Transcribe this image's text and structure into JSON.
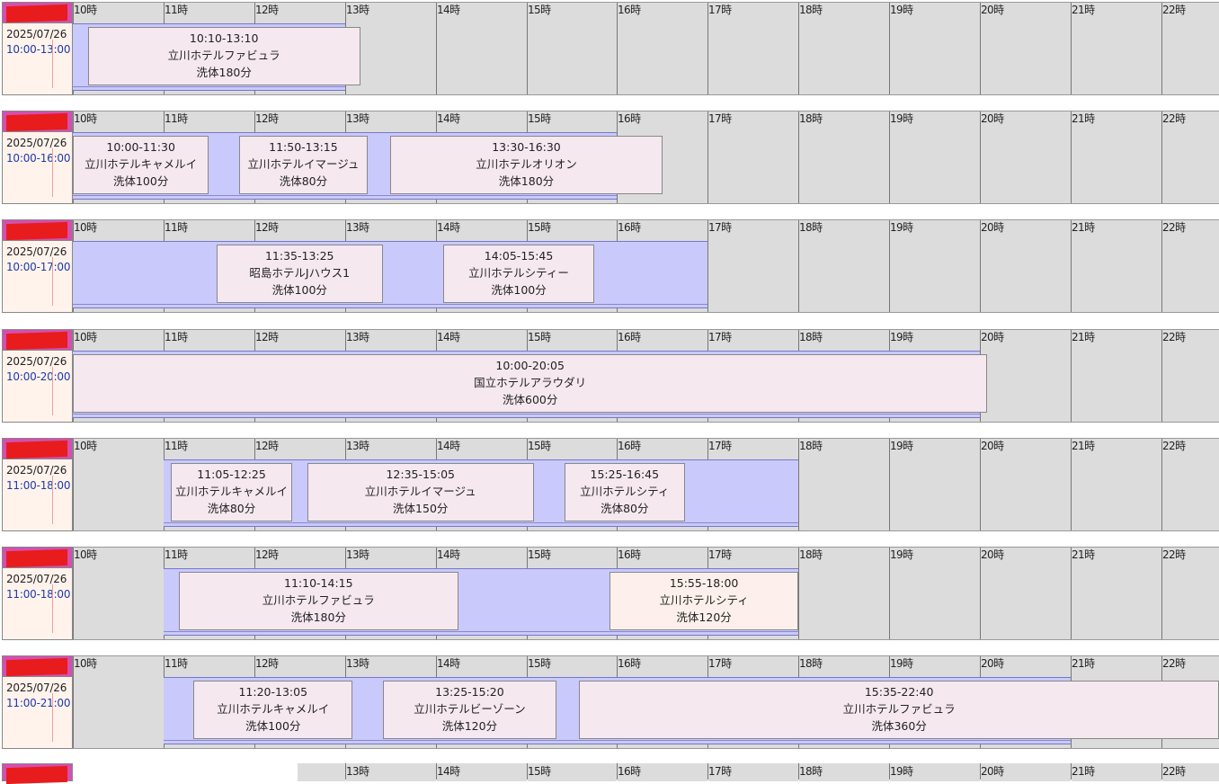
{
  "hours": [
    "10時",
    "11時",
    "12時",
    "13時",
    "14時",
    "15時",
    "16時",
    "17時",
    "18時",
    "19時",
    "20時",
    "21時",
    "22時"
  ],
  "rows": [
    {
      "date": "2025/07/26",
      "range": "10:00-13:00",
      "shift": [
        10,
        13
      ],
      "jobs": [
        {
          "time": "10:10-13:10",
          "place": "立川ホテルファビュラ",
          "wash": "洗体180分",
          "s": 10.167,
          "e": 13.167
        }
      ]
    },
    {
      "date": "2025/07/26",
      "range": "10:00-16:00",
      "shift": [
        10,
        16
      ],
      "jobs": [
        {
          "time": "10:00-11:30",
          "place": "立川ホテルキャメルイ",
          "wash": "洗体100分",
          "s": 10,
          "e": 11.5
        },
        {
          "time": "11:50-13:15",
          "place": "立川ホテルイマージュ",
          "wash": "洗体80分",
          "s": 11.833,
          "e": 13.25
        },
        {
          "time": "13:30-16:30",
          "place": "立川ホテルオリオン",
          "wash": "洗体180分",
          "s": 13.5,
          "e": 16.5
        }
      ]
    },
    {
      "date": "2025/07/26",
      "range": "10:00-17:00",
      "shift": [
        10,
        17
      ],
      "jobs": [
        {
          "time": "11:35-13:25",
          "place": "昭島ホテルJハウス1",
          "wash": "洗体100分",
          "s": 11.583,
          "e": 13.417
        },
        {
          "time": "14:05-15:45",
          "place": "立川ホテルシティー",
          "wash": "洗体100分",
          "s": 14.083,
          "e": 15.75
        }
      ]
    },
    {
      "date": "2025/07/26",
      "range": "10:00-20:00",
      "shift": [
        10,
        20
      ],
      "jobs": [
        {
          "time": "10:00-20:05",
          "place": "国立ホテルアラウダリ",
          "wash": "洗体600分",
          "s": 10,
          "e": 20.083
        }
      ]
    },
    {
      "date": "2025/07/26",
      "range": "11:00-18:00",
      "shift": [
        11,
        18
      ],
      "jobs": [
        {
          "time": "11:05-12:25",
          "place": "立川ホテルキャメルイ",
          "wash": "洗体80分",
          "s": 11.083,
          "e": 12.417
        },
        {
          "time": "12:35-15:05",
          "place": "立川ホテルイマージュ",
          "wash": "洗体150分",
          "s": 12.583,
          "e": 15.083
        },
        {
          "time": "15:25-16:45",
          "place": "立川ホテルシティ",
          "wash": "洗体80分",
          "s": 15.417,
          "e": 16.75
        }
      ]
    },
    {
      "date": "2025/07/26",
      "range": "11:00-18:00",
      "shift": [
        11,
        18
      ],
      "jobs": [
        {
          "time": "11:10-14:15",
          "place": "立川ホテルファビュラ",
          "wash": "洗体180分",
          "s": 11.167,
          "e": 14.25
        },
        {
          "time": "15:55-18:00",
          "place": "立川ホテルシティ",
          "wash": "洗体120分",
          "s": 15.917,
          "e": 18,
          "alt": true
        }
      ]
    },
    {
      "date": "2025/07/26",
      "range": "11:00-21:00",
      "shift": [
        11,
        21
      ],
      "jobs": [
        {
          "time": "11:20-13:05",
          "place": "立川ホテルキャメルイ",
          "wash": "洗体100分",
          "s": 11.333,
          "e": 13.083
        },
        {
          "time": "13:25-15:20",
          "place": "立川ホテルビーゾーン",
          "wash": "洗体120分",
          "s": 13.417,
          "e": 15.333
        },
        {
          "time": "15:35-22:40",
          "place": "立川ホテルファビュラ",
          "wash": "洗体360分",
          "s": 15.583,
          "e": 22.667
        }
      ]
    }
  ],
  "last_row_hours_visible_from": "13時"
}
